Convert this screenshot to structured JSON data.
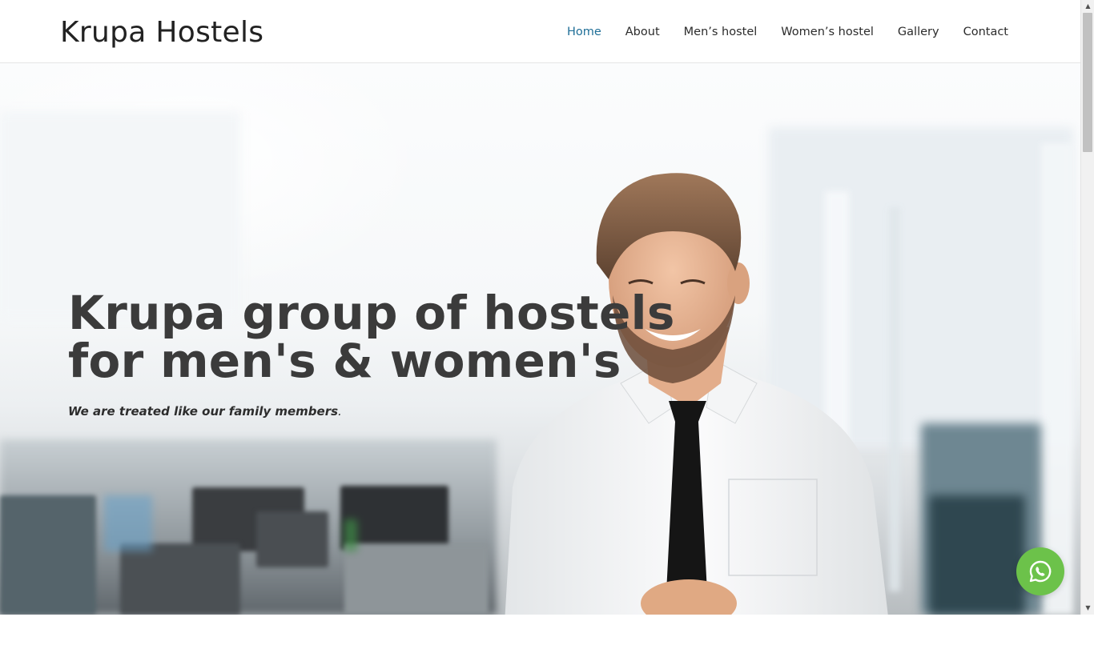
{
  "header": {
    "brand": "Krupa Hostels",
    "nav": [
      {
        "label": "Home",
        "active": true
      },
      {
        "label": "About"
      },
      {
        "label": "Men’s hostel"
      },
      {
        "label": "Women’s hostel"
      },
      {
        "label": "Gallery"
      },
      {
        "label": "Contact"
      }
    ]
  },
  "hero": {
    "title": "Krupa group of hostels\nfor men's & women's",
    "subtitle": "We are treated like our family members",
    "subtitle_end": "."
  },
  "floating": {
    "whatsapp_icon": "whatsapp-icon",
    "color": "#6cc24a"
  },
  "colors": {
    "nav_active": "#1e6e97",
    "heading": "#3b3b3b"
  }
}
